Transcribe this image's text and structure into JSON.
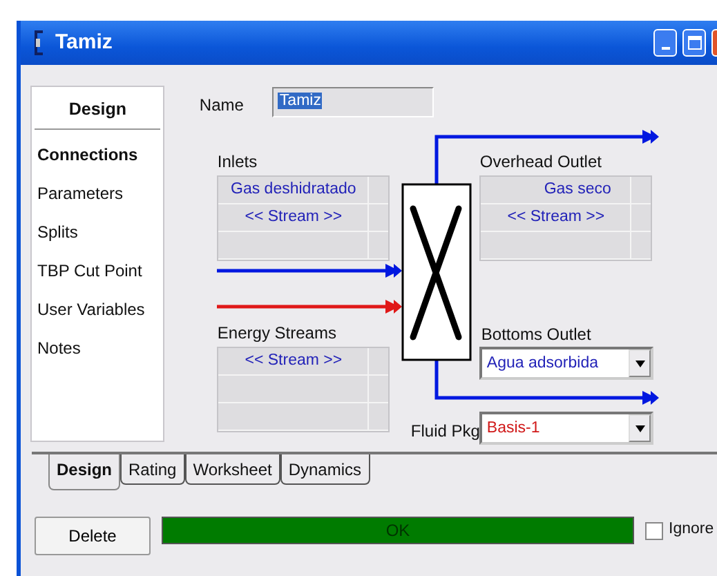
{
  "window": {
    "title": "Tamiz"
  },
  "nav": {
    "header": "Design",
    "items": [
      {
        "label": "Connections",
        "selected": true
      },
      {
        "label": "Parameters",
        "selected": false
      },
      {
        "label": "Splits",
        "selected": false
      },
      {
        "label": "TBP Cut Point",
        "selected": false
      },
      {
        "label": "User Variables",
        "selected": false
      },
      {
        "label": "Notes",
        "selected": false
      }
    ]
  },
  "name": {
    "label": "Name",
    "value": "Tamiz"
  },
  "inlets": {
    "label": "Inlets",
    "rows": [
      "Gas deshidratado",
      "<< Stream >>"
    ]
  },
  "energy_streams": {
    "label": "Energy Streams",
    "rows": [
      "<< Stream >>"
    ]
  },
  "overhead_outlet": {
    "label": "Overhead Outlet",
    "rows": [
      "Gas seco",
      "<< Stream >>"
    ]
  },
  "bottoms_outlet": {
    "label": "Bottoms Outlet",
    "value": "Agua adsorbida"
  },
  "fluid_pkg": {
    "label": "Fluid Pkg",
    "value": "Basis-1"
  },
  "tabs": [
    {
      "label": "Design",
      "selected": true
    },
    {
      "label": "Rating",
      "selected": false
    },
    {
      "label": "Worksheet",
      "selected": false
    },
    {
      "label": "Dynamics",
      "selected": false
    }
  ],
  "delete_button": "Delete",
  "status": {
    "text": "OK"
  },
  "ignored": {
    "label": "Ignore",
    "checked": false
  }
}
